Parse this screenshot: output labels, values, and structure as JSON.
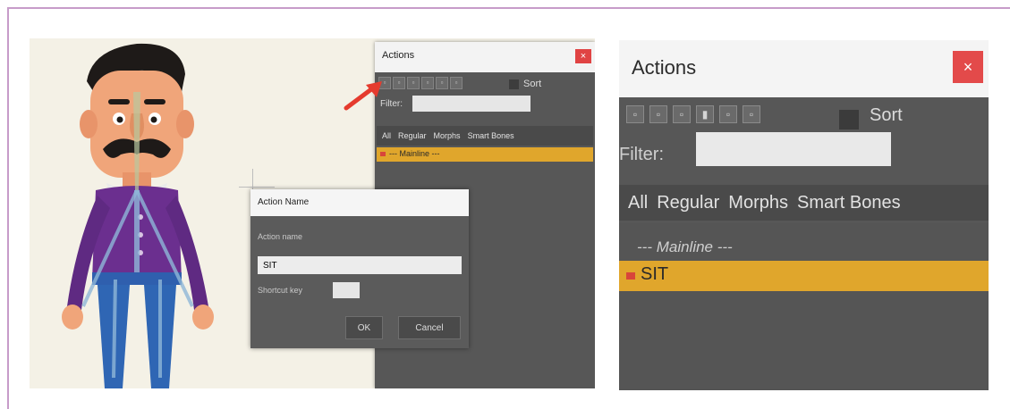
{
  "colors": {
    "frame": "#c79cc9",
    "panel_bg": "#575757",
    "selection": "#e0a62c",
    "close_button": "#e04343",
    "arrow": "#e53b2e"
  },
  "left_panel": {
    "actions_window": {
      "title": "Actions",
      "close_glyph": "×",
      "sort_label": "Sort",
      "filter_label": "Filter:",
      "tabs": [
        "All",
        "Regular",
        "Morphs",
        "Smart Bones"
      ],
      "mainline_row": "--- Mainline ---"
    },
    "action_name_dialog": {
      "title": "Action Name",
      "action_name_label": "Action name",
      "action_name_value": "SIT",
      "shortcut_label": "Shortcut key",
      "ok_label": "OK",
      "cancel_label": "Cancel"
    },
    "pointer_arrow_icon": "red-arrow-icon"
  },
  "right_panel": {
    "title": "Actions",
    "close_glyph": "×",
    "toolbar_icons": [
      "new-action-icon",
      "copy-action-icon",
      "duplicate-action-icon",
      "delete-action-icon",
      "insert-action-icon",
      "append-action-icon"
    ],
    "sort_label": "Sort",
    "filter_label": "Filter:",
    "tabs": [
      "All",
      "Regular",
      "Morphs",
      "Smart Bones"
    ],
    "mainline_row": "--- Mainline ---",
    "selected_action": "SIT"
  }
}
